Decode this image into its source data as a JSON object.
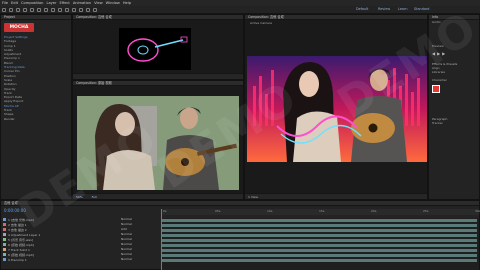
{
  "menu": [
    "File",
    "Edit",
    "Composition",
    "Layer",
    "Effect",
    "Animation",
    "View",
    "Window",
    "Help"
  ],
  "workspaces": [
    "Default",
    "Review",
    "Learn",
    "Standard"
  ],
  "project": {
    "tab": "Project",
    "item_name": "MOCHA",
    "items": [
      "Project Settings",
      "Footage",
      "Comp 1",
      "Solids",
      "Adjustment",
      "Precomp 1",
      "Audio",
      "Scene",
      "Layer 8",
      "Text 1"
    ]
  },
  "effects": {
    "tab": "Effect Controls",
    "rows": [
      "Mocha AE",
      "Track",
      "Shape",
      "Render",
      "Blend",
      "Tracking Data",
      "Corner Pin",
      "Position",
      "Scale",
      "Rotation",
      "Opacity",
      "Track",
      "Export Data",
      "Apply Export"
    ]
  },
  "comp_top": {
    "tab": "Composition: 吉他 合成"
  },
  "comp_bottom": {
    "tab": "Composition: 原始 视频",
    "zoom": "50%",
    "view": "Full"
  },
  "comp_right": {
    "tab": "Composition: 吉他 合成",
    "camera": "Active Camera",
    "views": "1 View"
  },
  "right_panel": {
    "tab": "Info",
    "sections": [
      "Audio",
      "Preview",
      "Effects & Presets",
      "Align",
      "Libraries",
      "Character",
      "Paragraph",
      "Tracker"
    ]
  },
  "timeline": {
    "tab": "吉他 合成",
    "timecode": "0:00:00:00",
    "layers": [
      {
        "num": "1",
        "name": "[吉他 光效.mp4]",
        "mode": "Normal",
        "color": "#6b9ad0"
      },
      {
        "num": "2",
        "name": "吉他 描边 1",
        "mode": "Normal",
        "color": "#c96f6f"
      },
      {
        "num": "3",
        "name": "吉他 描边 2",
        "mode": "Add",
        "color": "#c96f6f"
      },
      {
        "num": "4",
        "name": "Adjustment Layer 1",
        "mode": "Normal",
        "color": "#a89ad0"
      },
      {
        "num": "5",
        "name": "[背景 音乐.wav]",
        "mode": "Normal",
        "color": "#7fbf7f"
      },
      {
        "num": "6",
        "name": "[原始 视频.mp4]",
        "mode": "Normal",
        "color": "#7fb0b0"
      },
      {
        "num": "7",
        "name": "Track Solid 1",
        "mode": "Normal",
        "color": "#c9a96f"
      },
      {
        "num": "8",
        "name": "[原始 视频.mp4]",
        "mode": "Normal",
        "color": "#7fb0b0"
      },
      {
        "num": "9",
        "name": "Precomp 1",
        "mode": "Normal",
        "color": "#6b9ad0"
      }
    ],
    "ruler": [
      "0s",
      "05s",
      "10s",
      "15s",
      "20s",
      "25s",
      "30s"
    ]
  },
  "watermark": "DEMO",
  "colors": {
    "accent": "#2d8ceb",
    "tl_bar": "#5a7a7a"
  }
}
